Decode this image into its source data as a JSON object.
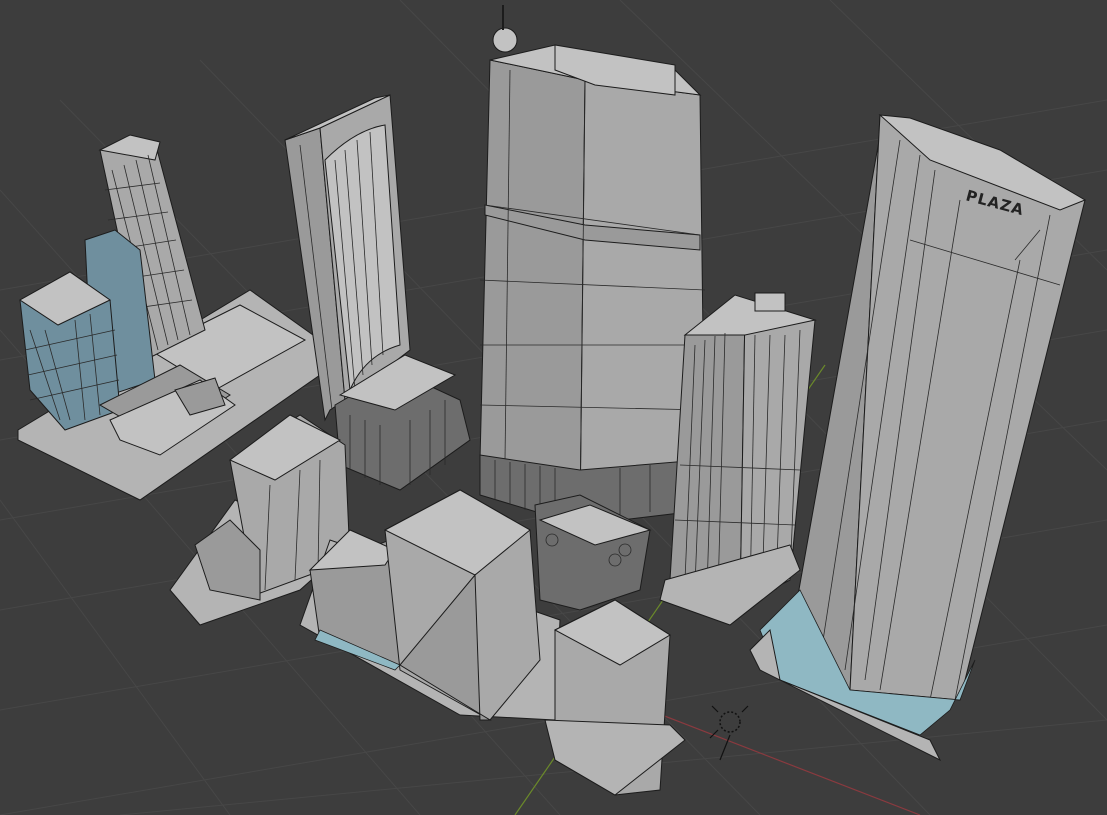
{
  "viewport": {
    "background": "#3d3d3d",
    "signage": {
      "plaza_sign": "PLAZA"
    },
    "axes": {
      "x_color": "#8a3a3f",
      "y_color": "#6b8a2a"
    },
    "icons": [
      "light-object-icon"
    ]
  }
}
